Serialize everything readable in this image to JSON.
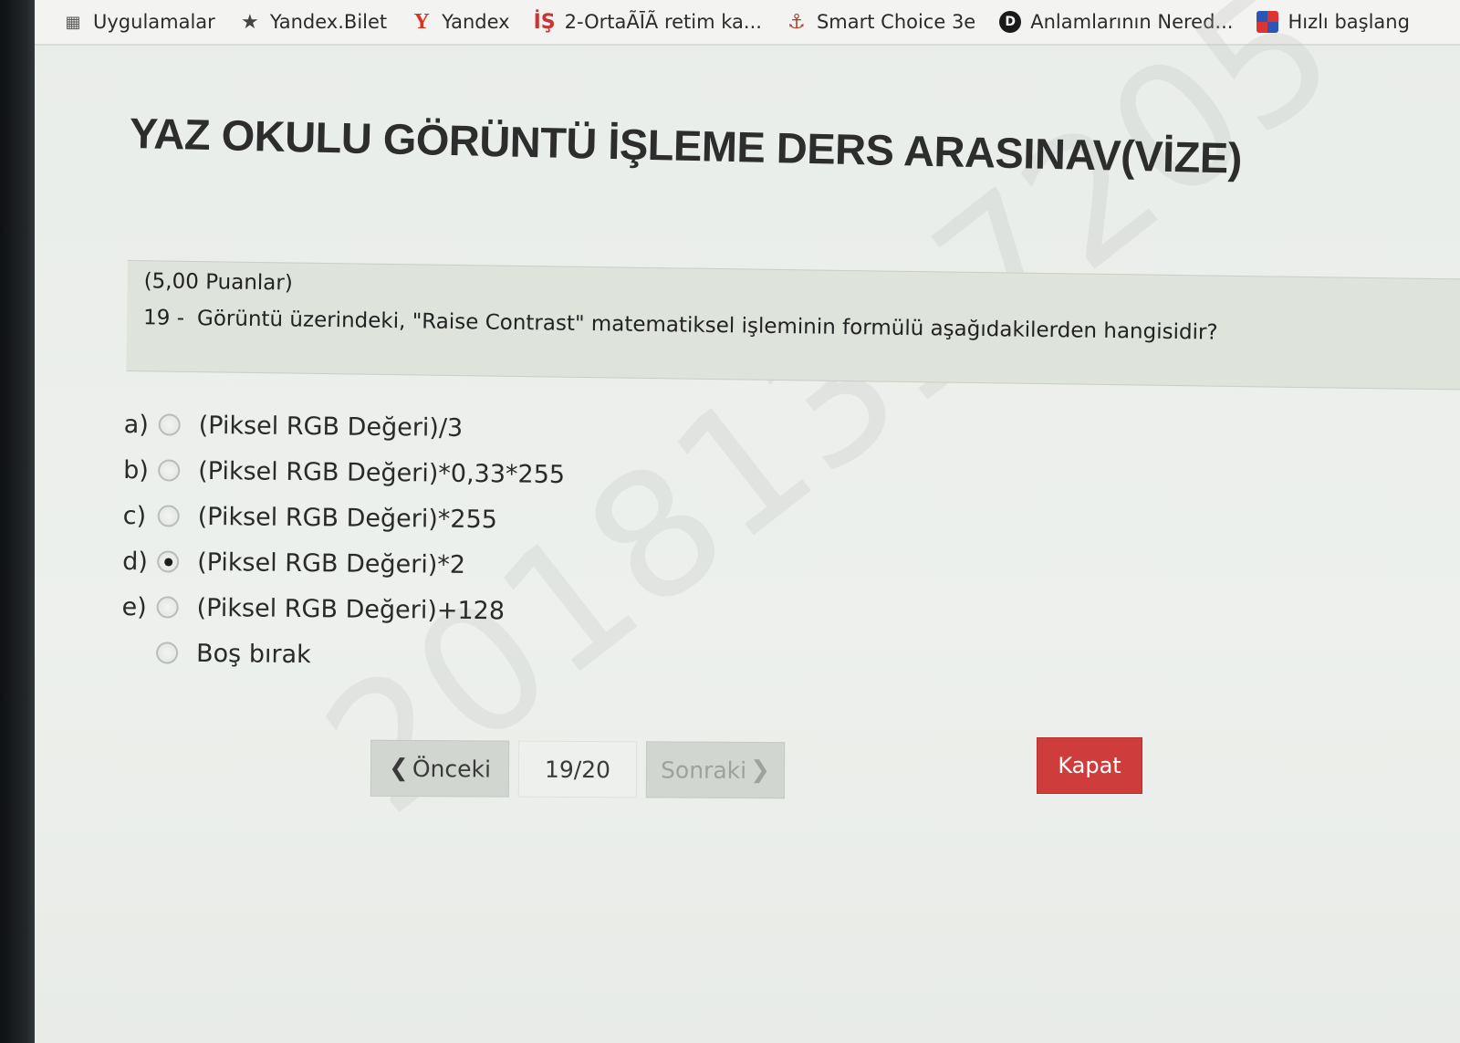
{
  "bookmarks": [
    {
      "icon": "apps-icon",
      "glyph": "▦",
      "label": "Uygulamalar"
    },
    {
      "icon": "star-icon",
      "glyph": "★",
      "label": "Yandex.Bilet"
    },
    {
      "icon": "yandex-icon",
      "glyph": "Y",
      "label": "Yandex"
    },
    {
      "icon": "is-icon",
      "glyph": "İŞ",
      "label": "2-OrtaÃĪÃ retim ka..."
    },
    {
      "icon": "smart-choice-icon",
      "glyph": "⚓",
      "label": "Smart Choice 3e"
    },
    {
      "icon": "dictionary-icon",
      "glyph": "D",
      "label": "Anlamlarının Nered..."
    },
    {
      "icon": "quick-start-icon",
      "glyph": "",
      "label": "Hızlı başlang"
    }
  ],
  "page": {
    "title": "YAZ OKULU GÖRÜNTÜ İŞLEME DERS ARASINAV(VİZE)"
  },
  "question": {
    "points": "(5,00 Puanlar)",
    "number": "19 -",
    "text": "Görüntü üzerindeki, \"Raise Contrast\" matematiksel işleminin formülü aşağıdakilerden hangisidir?"
  },
  "options": [
    {
      "letter": "a)",
      "label": "(Piksel RGB Değeri)/3",
      "checked": false
    },
    {
      "letter": "b)",
      "label": "(Piksel RGB Değeri)*0,33*255",
      "checked": false
    },
    {
      "letter": "c)",
      "label": "(Piksel RGB Değeri)*255",
      "checked": false
    },
    {
      "letter": "d)",
      "label": "(Piksel RGB Değeri)*2",
      "checked": true
    },
    {
      "letter": "e)",
      "label": "(Piksel RGB Değeri)+128",
      "checked": false
    }
  ],
  "blank_option": {
    "label": "Boş bırak",
    "checked": false
  },
  "watermark": "20181317205",
  "navigation": {
    "prev_label": "Önceki",
    "page_indicator": "19/20",
    "next_label": "Sonraki",
    "close_label": "Kapat"
  },
  "colors": {
    "close_button": "#cf3c3c",
    "question_bg": "#dee4dc"
  }
}
